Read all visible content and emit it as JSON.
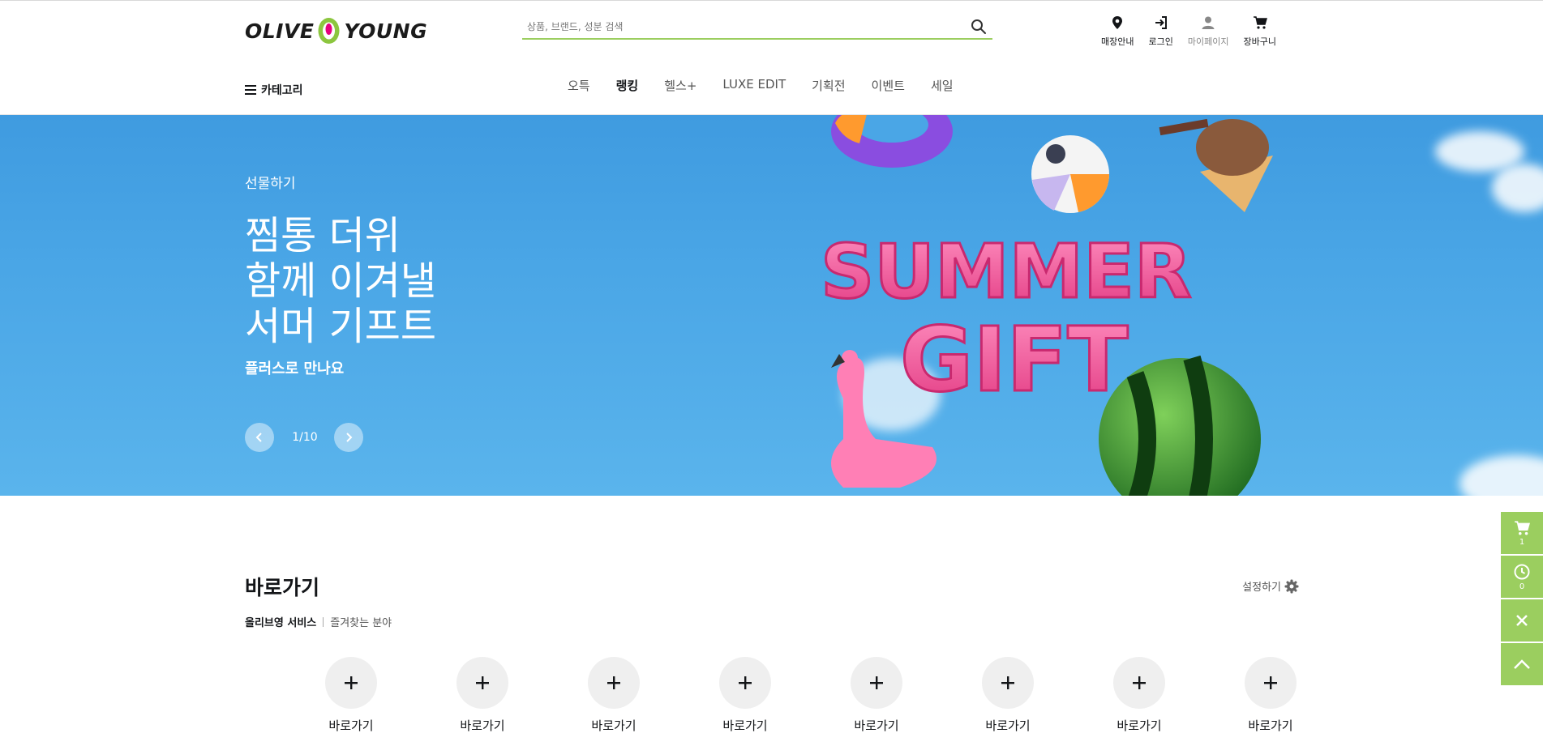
{
  "header": {
    "logo": {
      "left": "OLIVE",
      "right": "YOUNG"
    },
    "search": {
      "placeholder": "상품, 브랜드, 성분 검색",
      "value": ""
    },
    "utils": [
      {
        "label": "매장안내",
        "icon": "map-pin-icon"
      },
      {
        "label": "로그인",
        "icon": "login-icon"
      },
      {
        "label": "마이페이지",
        "icon": "user-icon"
      },
      {
        "label": "장바구니",
        "icon": "cart-icon"
      }
    ],
    "category_label": "카테고리",
    "nav": [
      "오특",
      "랭킹",
      "헬스+",
      "LUXE EDIT",
      "기획전",
      "이벤트",
      "세일"
    ],
    "nav_active": "랭킹"
  },
  "banner": {
    "kicker": "선물하기",
    "title_lines": [
      "찜통 더위",
      "함께 이겨낼",
      "서머 기프트"
    ],
    "subtitle": "플러스로 만나요",
    "pager": "1/10",
    "art_text": [
      "SUMMER",
      "GIFT"
    ]
  },
  "quick": {
    "title": "바로가기",
    "tab_active": "올리브영 서비스",
    "tab_other": "즐겨찾는 분야",
    "settings_label": "설정하기",
    "items": [
      "바로가기",
      "바로가기",
      "바로가기",
      "바로가기",
      "바로가기",
      "바로가기",
      "바로가기",
      "바로가기"
    ]
  },
  "side_bar": {
    "cart_count": "1",
    "recent_count": "0"
  },
  "colors": {
    "accent": "#9bce5f",
    "banner_blue": "#4aa6e6",
    "logo_green": "#8cc63f",
    "logo_pink": "#e6007e"
  }
}
